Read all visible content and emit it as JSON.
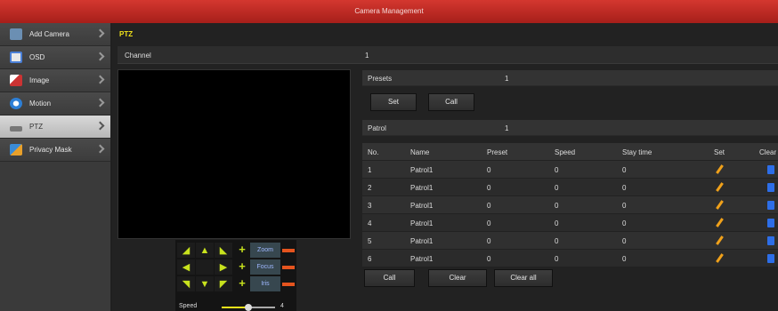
{
  "window": {
    "title": "Camera Management"
  },
  "sidebar": {
    "items": [
      {
        "label": "Add Camera",
        "icon": "camera-add-icon",
        "color": "#6b8fb3"
      },
      {
        "label": "OSD",
        "icon": "osd-icon",
        "color": "#4a7fd6"
      },
      {
        "label": "Image",
        "icon": "image-icon",
        "color": "#cc3333"
      },
      {
        "label": "Motion",
        "icon": "motion-icon",
        "color": "#2d7fd6"
      },
      {
        "label": "PTZ",
        "icon": "ptz-icon",
        "color": "#777777"
      },
      {
        "label": "Privacy Mask",
        "icon": "privacy-mask-icon",
        "color": "#3a8bd6"
      }
    ],
    "active": "PTZ"
  },
  "main": {
    "heading": "PTZ",
    "channel": {
      "label": "Channel",
      "value": "1"
    },
    "presets": {
      "label": "Presets",
      "value": "1",
      "set_label": "Set",
      "call_label": "Call"
    },
    "patrol": {
      "label": "Patrol",
      "value": "1"
    },
    "ptz_controls": {
      "zoom_label": "Zoom",
      "focus_label": "Focus",
      "iris_label": "Iris",
      "speed_label": "Speed",
      "speed_value": "4",
      "speed_fraction": 0.5
    },
    "table": {
      "headers": [
        "No.",
        "Name",
        "Preset",
        "Speed",
        "Stay time",
        "Set",
        "Clear"
      ],
      "rows": [
        {
          "no": "1",
          "name": "Patrol1",
          "preset": "0",
          "speed": "0",
          "stay": "0"
        },
        {
          "no": "2",
          "name": "Patrol1",
          "preset": "0",
          "speed": "0",
          "stay": "0"
        },
        {
          "no": "3",
          "name": "Patrol1",
          "preset": "0",
          "speed": "0",
          "stay": "0"
        },
        {
          "no": "4",
          "name": "Patrol1",
          "preset": "0",
          "speed": "0",
          "stay": "0"
        },
        {
          "no": "5",
          "name": "Patrol1",
          "preset": "0",
          "speed": "0",
          "stay": "0"
        },
        {
          "no": "6",
          "name": "Patrol1",
          "preset": "0",
          "speed": "0",
          "stay": "0"
        }
      ]
    },
    "buttons": {
      "call": "Call",
      "clear": "Clear",
      "clear_all": "Clear all"
    }
  },
  "colors": {
    "accent_yellow": "#f0e21a",
    "title_red": "#c62d26",
    "edit_orange": "#f0a11a",
    "clear_blue": "#2d6ee8"
  }
}
